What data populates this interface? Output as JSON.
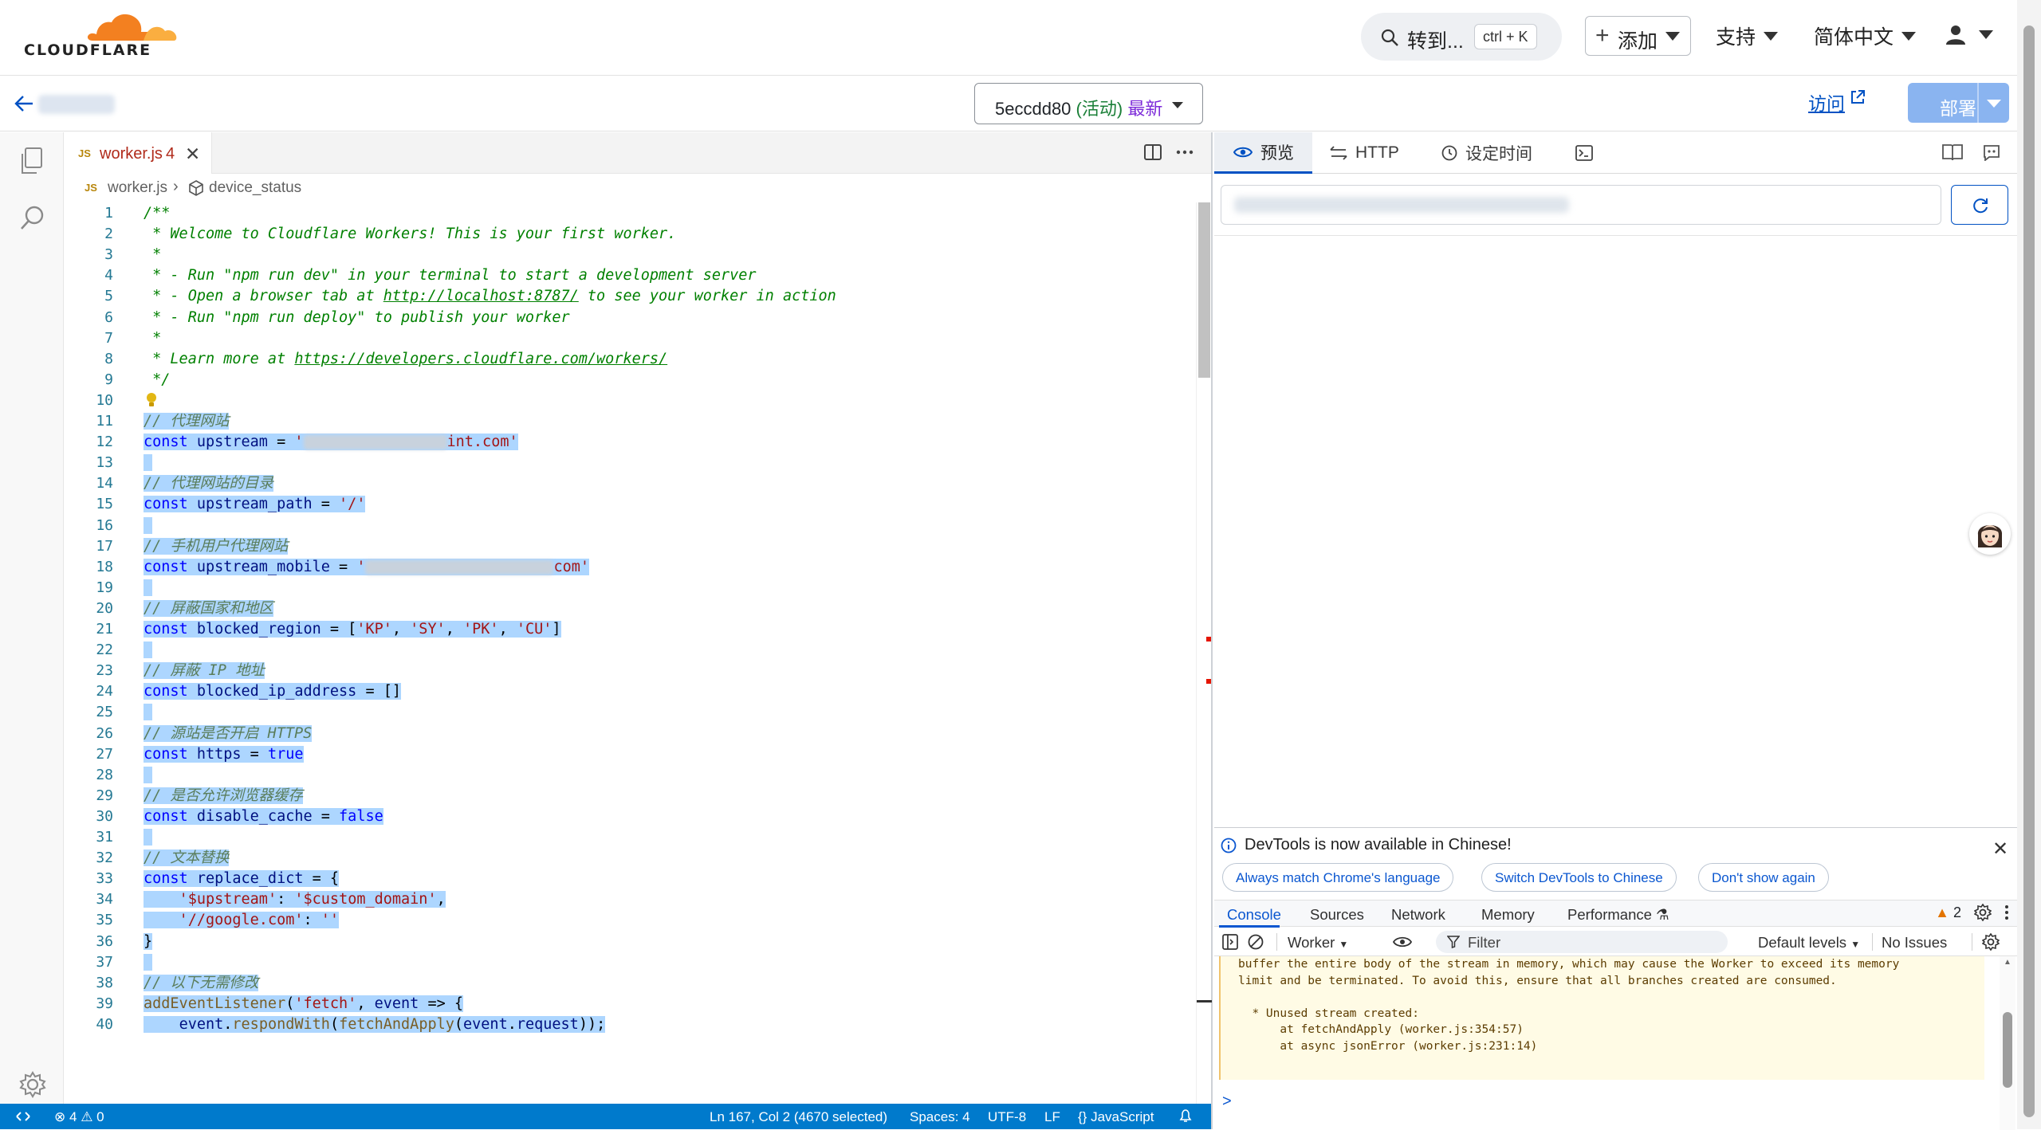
{
  "brand": {
    "name": "CLOUDFLARE",
    "orange": "#f38020",
    "orange_light": "#faae40"
  },
  "topnav": {
    "search_label": "转到...",
    "search_shortcut": "ctrl + K",
    "add_label": "添加",
    "support_label": "支持",
    "language_label": "简体中文"
  },
  "subheader": {
    "version_id": "5eccdd80",
    "version_status": "(活动)",
    "version_tag": "最新",
    "visit_label": "访问",
    "deploy_label": "部署"
  },
  "editor": {
    "tab": {
      "lang_badge": "JS",
      "filename": "worker.js",
      "problems": "4"
    },
    "breadcrumb": {
      "file": "worker.js",
      "symbol": "device_status"
    },
    "lines": [
      {
        "n": "1",
        "sel": false,
        "tokens": [
          [
            "c-com",
            "/**"
          ]
        ]
      },
      {
        "n": "2",
        "sel": false,
        "tokens": [
          [
            "c-com",
            " * Welcome to Cloudflare Workers! This is your first worker."
          ]
        ]
      },
      {
        "n": "3",
        "sel": false,
        "tokens": [
          [
            "c-com",
            " *"
          ]
        ]
      },
      {
        "n": "4",
        "sel": false,
        "tokens": [
          [
            "c-com",
            " * - Run \"npm run dev\" in your terminal to start a development server"
          ]
        ]
      },
      {
        "n": "5",
        "sel": false,
        "tokens": [
          [
            "c-com",
            " * - Open a browser tab at "
          ],
          [
            "c-com c-lnk",
            "http://localhost:8787/"
          ],
          [
            "c-com",
            " to see your worker in action"
          ]
        ]
      },
      {
        "n": "6",
        "sel": false,
        "tokens": [
          [
            "c-com",
            " * - Run \"npm run deploy\" to publish your worker"
          ]
        ]
      },
      {
        "n": "7",
        "sel": false,
        "tokens": [
          [
            "c-com",
            " *"
          ]
        ]
      },
      {
        "n": "8",
        "sel": false,
        "tokens": [
          [
            "c-com",
            " * Learn more at "
          ],
          [
            "c-com c-lnk",
            "https://developers.cloudflare.com/workers/"
          ]
        ]
      },
      {
        "n": "9",
        "sel": false,
        "tokens": [
          [
            "c-com",
            " */"
          ]
        ]
      },
      {
        "n": "10",
        "sel": false,
        "tokens": []
      },
      {
        "n": "11",
        "sel": true,
        "tokens": [
          [
            "c-com-sel",
            "// 代理网站"
          ]
        ]
      },
      {
        "n": "12",
        "sel": true,
        "tokens": [
          [
            "c-kw",
            "const "
          ],
          [
            "c-id",
            "upstream"
          ],
          [
            "c-def",
            " = "
          ],
          [
            "c-str",
            "'"
          ],
          [
            "redact",
            ""
          ],
          [
            "c-str",
            "int.com'"
          ]
        ]
      },
      {
        "n": "13",
        "sel": true,
        "tokens": [
          [
            "c-def",
            " "
          ]
        ]
      },
      {
        "n": "14",
        "sel": true,
        "tokens": [
          [
            "c-com-sel",
            "// 代理网站的目录"
          ]
        ]
      },
      {
        "n": "15",
        "sel": true,
        "tokens": [
          [
            "c-kw",
            "const "
          ],
          [
            "c-id",
            "upstream_path"
          ],
          [
            "c-def",
            " = "
          ],
          [
            "c-str",
            "'/'"
          ]
        ]
      },
      {
        "n": "16",
        "sel": true,
        "tokens": [
          [
            "c-def",
            " "
          ]
        ]
      },
      {
        "n": "17",
        "sel": true,
        "tokens": [
          [
            "c-com-sel",
            "// 手机用户代理网站"
          ]
        ]
      },
      {
        "n": "18",
        "sel": true,
        "tokens": [
          [
            "c-kw",
            "const "
          ],
          [
            "c-id",
            "upstream_mobile"
          ],
          [
            "c-def",
            " = "
          ],
          [
            "c-str",
            "'"
          ],
          [
            "redact",
            ""
          ],
          [
            "c-str",
            "com'"
          ]
        ]
      },
      {
        "n": "19",
        "sel": true,
        "tokens": [
          [
            "c-def",
            " "
          ]
        ]
      },
      {
        "n": "20",
        "sel": true,
        "tokens": [
          [
            "c-com-sel",
            "// 屏蔽国家和地区"
          ]
        ]
      },
      {
        "n": "21",
        "sel": true,
        "tokens": [
          [
            "c-kw",
            "const "
          ],
          [
            "c-id",
            "blocked_region"
          ],
          [
            "c-def",
            " = ["
          ],
          [
            "c-str",
            "'KP'"
          ],
          [
            "c-def",
            ", "
          ],
          [
            "c-str",
            "'SY'"
          ],
          [
            "c-def",
            ", "
          ],
          [
            "c-str",
            "'PK'"
          ],
          [
            "c-def",
            ", "
          ],
          [
            "c-str",
            "'CU'"
          ],
          [
            "c-def",
            "]"
          ]
        ]
      },
      {
        "n": "22",
        "sel": true,
        "tokens": [
          [
            "c-def",
            " "
          ]
        ]
      },
      {
        "n": "23",
        "sel": true,
        "tokens": [
          [
            "c-com-sel",
            "// 屏蔽 IP 地址"
          ]
        ]
      },
      {
        "n": "24",
        "sel": true,
        "tokens": [
          [
            "c-kw",
            "const "
          ],
          [
            "c-id",
            "blocked_ip_address"
          ],
          [
            "c-def",
            " = []"
          ]
        ]
      },
      {
        "n": "25",
        "sel": true,
        "tokens": [
          [
            "c-def",
            " "
          ]
        ]
      },
      {
        "n": "26",
        "sel": true,
        "tokens": [
          [
            "c-com-sel",
            "// 源站是否开启 HTTPS"
          ]
        ]
      },
      {
        "n": "27",
        "sel": true,
        "tokens": [
          [
            "c-kw",
            "const "
          ],
          [
            "c-id",
            "https"
          ],
          [
            "c-def",
            " = "
          ],
          [
            "c-kw",
            "true"
          ]
        ]
      },
      {
        "n": "28",
        "sel": true,
        "tokens": [
          [
            "c-def",
            " "
          ]
        ]
      },
      {
        "n": "29",
        "sel": true,
        "tokens": [
          [
            "c-com-sel",
            "// 是否允许浏览器缓存"
          ]
        ]
      },
      {
        "n": "30",
        "sel": true,
        "tokens": [
          [
            "c-kw",
            "const "
          ],
          [
            "c-id",
            "disable_cache"
          ],
          [
            "c-def",
            " = "
          ],
          [
            "c-kw",
            "false"
          ]
        ]
      },
      {
        "n": "31",
        "sel": true,
        "tokens": [
          [
            "c-def",
            " "
          ]
        ]
      },
      {
        "n": "32",
        "sel": true,
        "tokens": [
          [
            "c-com-sel",
            "// 文本替换"
          ]
        ]
      },
      {
        "n": "33",
        "sel": true,
        "tokens": [
          [
            "c-kw",
            "const "
          ],
          [
            "c-id",
            "replace_dict"
          ],
          [
            "c-def",
            " = {"
          ]
        ]
      },
      {
        "n": "34",
        "sel": true,
        "tokens": [
          [
            "c-def",
            "    "
          ],
          [
            "c-str",
            "'$upstream'"
          ],
          [
            "c-def",
            ": "
          ],
          [
            "c-str",
            "'$custom_domain'"
          ],
          [
            "c-def",
            ","
          ]
        ]
      },
      {
        "n": "35",
        "sel": true,
        "tokens": [
          [
            "c-def",
            "    "
          ],
          [
            "c-str",
            "'//google.com'"
          ],
          [
            "c-def",
            ": "
          ],
          [
            "c-str",
            "''"
          ]
        ]
      },
      {
        "n": "36",
        "sel": true,
        "tokens": [
          [
            "c-def",
            "}"
          ]
        ]
      },
      {
        "n": "37",
        "sel": true,
        "tokens": [
          [
            "c-def",
            " "
          ]
        ]
      },
      {
        "n": "38",
        "sel": true,
        "tokens": [
          [
            "c-com-sel",
            "// 以下无需修改"
          ]
        ]
      },
      {
        "n": "39",
        "sel": true,
        "tokens": [
          [
            "c-fn",
            "addEventListener"
          ],
          [
            "c-def",
            "("
          ],
          [
            "c-str",
            "'fetch'"
          ],
          [
            "c-def",
            ", "
          ],
          [
            "c-id",
            "event"
          ],
          [
            "c-def",
            " => {"
          ]
        ]
      },
      {
        "n": "40",
        "sel": true,
        "tokens": [
          [
            "c-def",
            "    "
          ],
          [
            "c-id",
            "event"
          ],
          [
            "c-def",
            "."
          ],
          [
            "c-fn",
            "respondWith"
          ],
          [
            "c-def",
            "("
          ],
          [
            "c-fn",
            "fetchAndApply"
          ],
          [
            "c-def",
            "("
          ],
          [
            "c-id",
            "event"
          ],
          [
            "c-def",
            "."
          ],
          [
            "c-id",
            "request"
          ],
          [
            "c-def",
            "));"
          ]
        ]
      }
    ]
  },
  "statusbar": {
    "errors": "4",
    "warnings": "0",
    "position": "Ln 167, Col 2 (4670 selected)",
    "spaces": "Spaces: 4",
    "encoding": "UTF-8",
    "eol": "LF",
    "language": "JavaScript"
  },
  "preview": {
    "tabs": [
      "预览",
      "HTTP",
      "设定时间"
    ],
    "active_tab": "预览"
  },
  "devtools": {
    "info": "DevTools is now available in Chinese!",
    "buttons": [
      "Always match Chrome's language",
      "Switch DevTools to Chinese",
      "Don't show again"
    ],
    "tabs": [
      "Console",
      "Sources",
      "Network",
      "Memory",
      "Performance"
    ],
    "warning_count": "2",
    "context": "Worker",
    "filter_placeholder": "Filter",
    "levels": "Default levels",
    "issues": "No Issues",
    "console_lines": [
      "buffer the entire body of the stream in memory, which may cause the Worker to exceed its memory",
      "limit and be terminated. To avoid this, ensure that all branches created are consumed.",
      "",
      "  * Unused stream created:",
      "      at fetchAndApply (worker.js:354:57)",
      "      at async jsonError (worker.js:231:14)"
    ],
    "prompt": ">"
  }
}
